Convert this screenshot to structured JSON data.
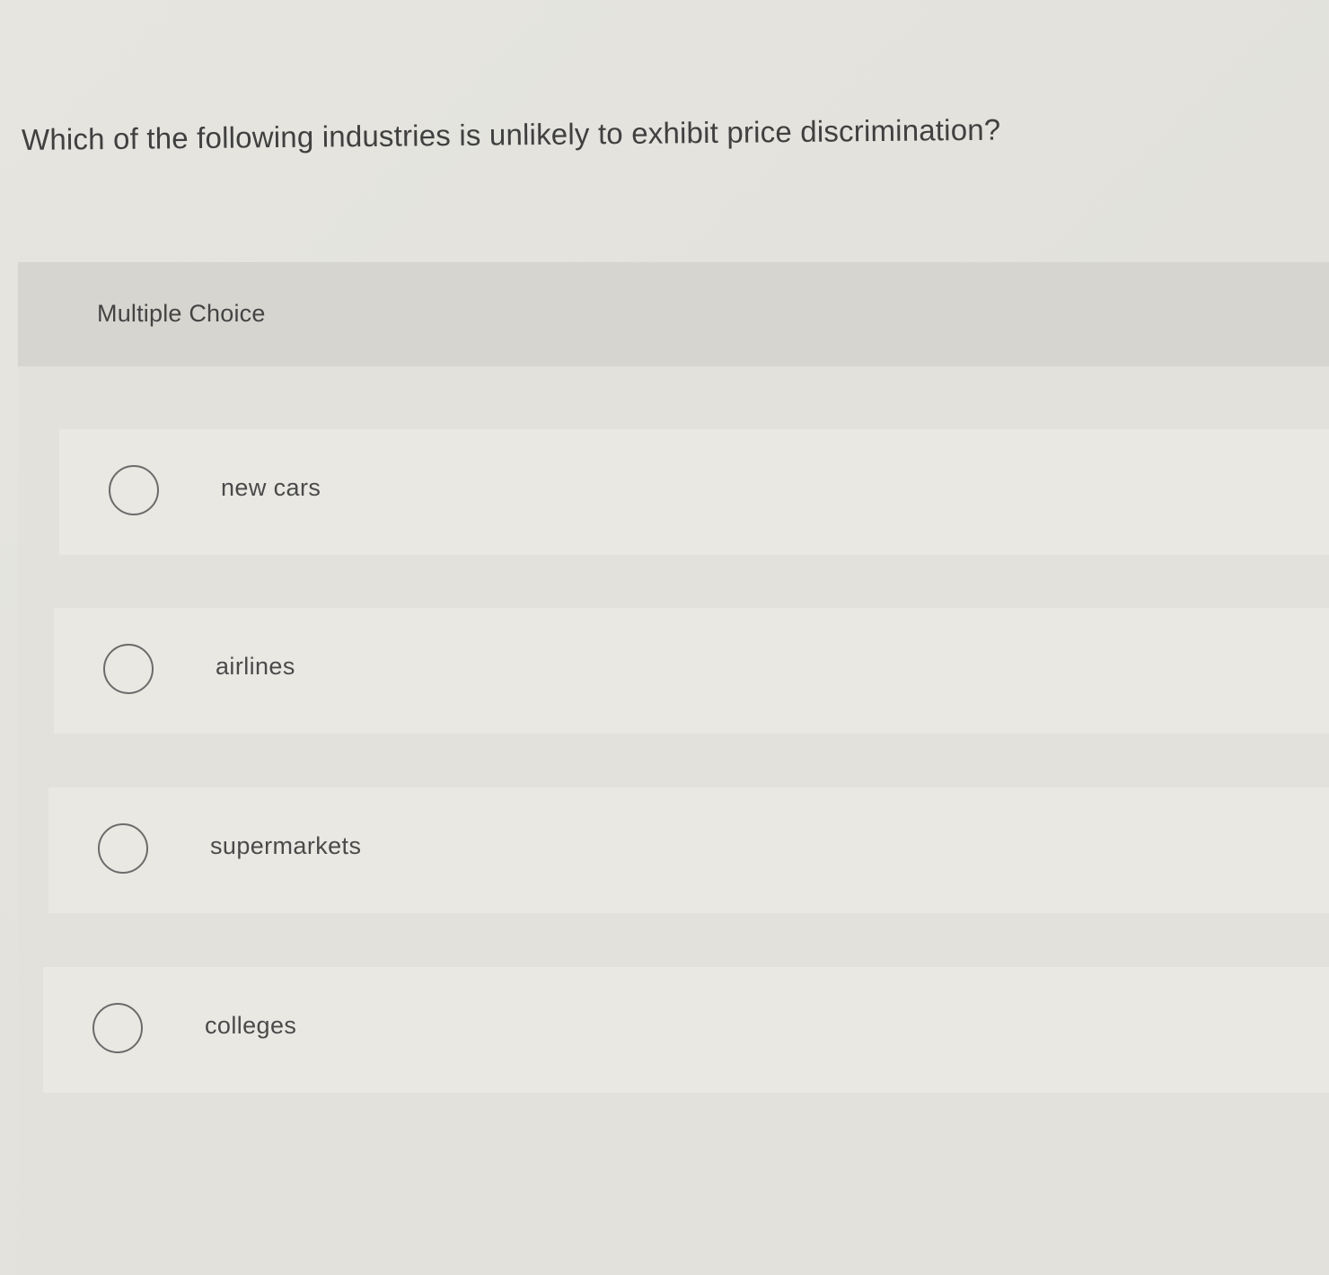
{
  "question": {
    "text": "Which of the following industries is unlikely to exhibit price discrimination?"
  },
  "multiple_choice": {
    "header_label": "Multiple Choice",
    "options": [
      {
        "label": "new cars",
        "selected": false
      },
      {
        "label": "airlines",
        "selected": false
      },
      {
        "label": "supermarkets",
        "selected": false
      },
      {
        "label": "colleges",
        "selected": false
      }
    ]
  }
}
